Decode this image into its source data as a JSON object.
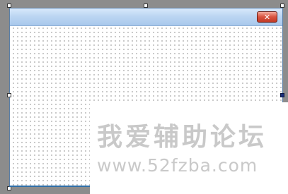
{
  "form": {
    "close_glyph": "✕"
  },
  "watermark": {
    "text_cn": "我爱辅助论坛",
    "text_url": "www.52fzba.com"
  },
  "colors": {
    "surface": "#8c8c8c",
    "titlebar_top": "#d8e9fb",
    "titlebar_bottom": "#a9c8ec",
    "close_button": "#d9533f",
    "active_grip": "#1a2d7a",
    "watermark_text": "#c9c9c9"
  },
  "icons": {
    "close": "close-icon"
  }
}
